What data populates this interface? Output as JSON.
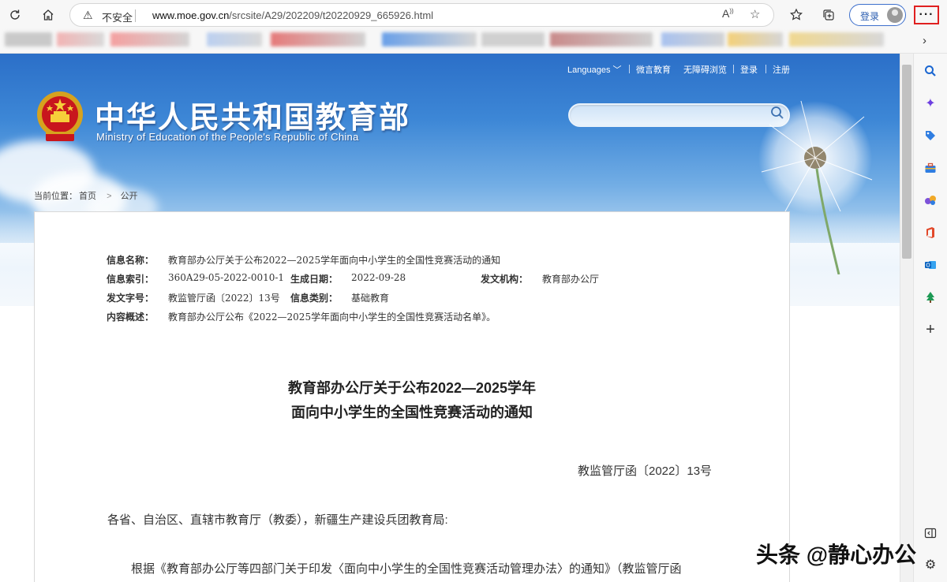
{
  "browser": {
    "security_label": "不安全",
    "url_domain": "www.moe.gov.cn",
    "url_path": "/srcsite/A29/202209/t20220929_665926.html",
    "login_label": "登录",
    "more_label": "···"
  },
  "site": {
    "title": "中华人民共和国教育部",
    "subtitle": "Ministry of Education of the People's Republic of China",
    "nav": {
      "languages": "Languages ﹀",
      "weiyan": "微言教育",
      "accessible": "无障碍浏览",
      "login": "登录",
      "register": "注册"
    },
    "search_placeholder": ""
  },
  "breadcrumb": {
    "prefix": "当前位置：",
    "home": "首页",
    "sep": ">",
    "current": "公开"
  },
  "meta": {
    "name_label": "信息名称：",
    "name_value": "教育部办公厅关于公布2022—2025学年面向中小学生的全国性竞赛活动的通知",
    "index_label": "信息索引：",
    "index_value": "360A29-05-2022-0010-1",
    "date_label": "生成日期：",
    "date_value": "2022-09-28",
    "org_label": "发文机构：",
    "org_value": "教育部办公厅",
    "docno_label": "发文字号：",
    "docno_value": "教监管厅函〔2022〕13号",
    "category_label": "信息类别：",
    "category_value": "基础教育",
    "summary_label": "内容概述：",
    "summary_value": "教育部办公厅公布《2022—2025学年面向中小学生的全国性竞赛活动名单》。"
  },
  "document": {
    "title_line1": "教育部办公厅关于公布2022—2025学年",
    "title_line2": "面向中小学生的全国性竞赛活动的通知",
    "doc_number": "教监管厅函〔2022〕13号",
    "salutation": "各省、自治区、直辖市教育厅（教委），新疆生产建设兵团教育局:",
    "para1": "根据《教育部办公厅等四部门关于印发〈面向中小学生的全国性竞赛活动管理办法〉的通知》（教监管厅函"
  },
  "watermark": "头条 @静心办公"
}
